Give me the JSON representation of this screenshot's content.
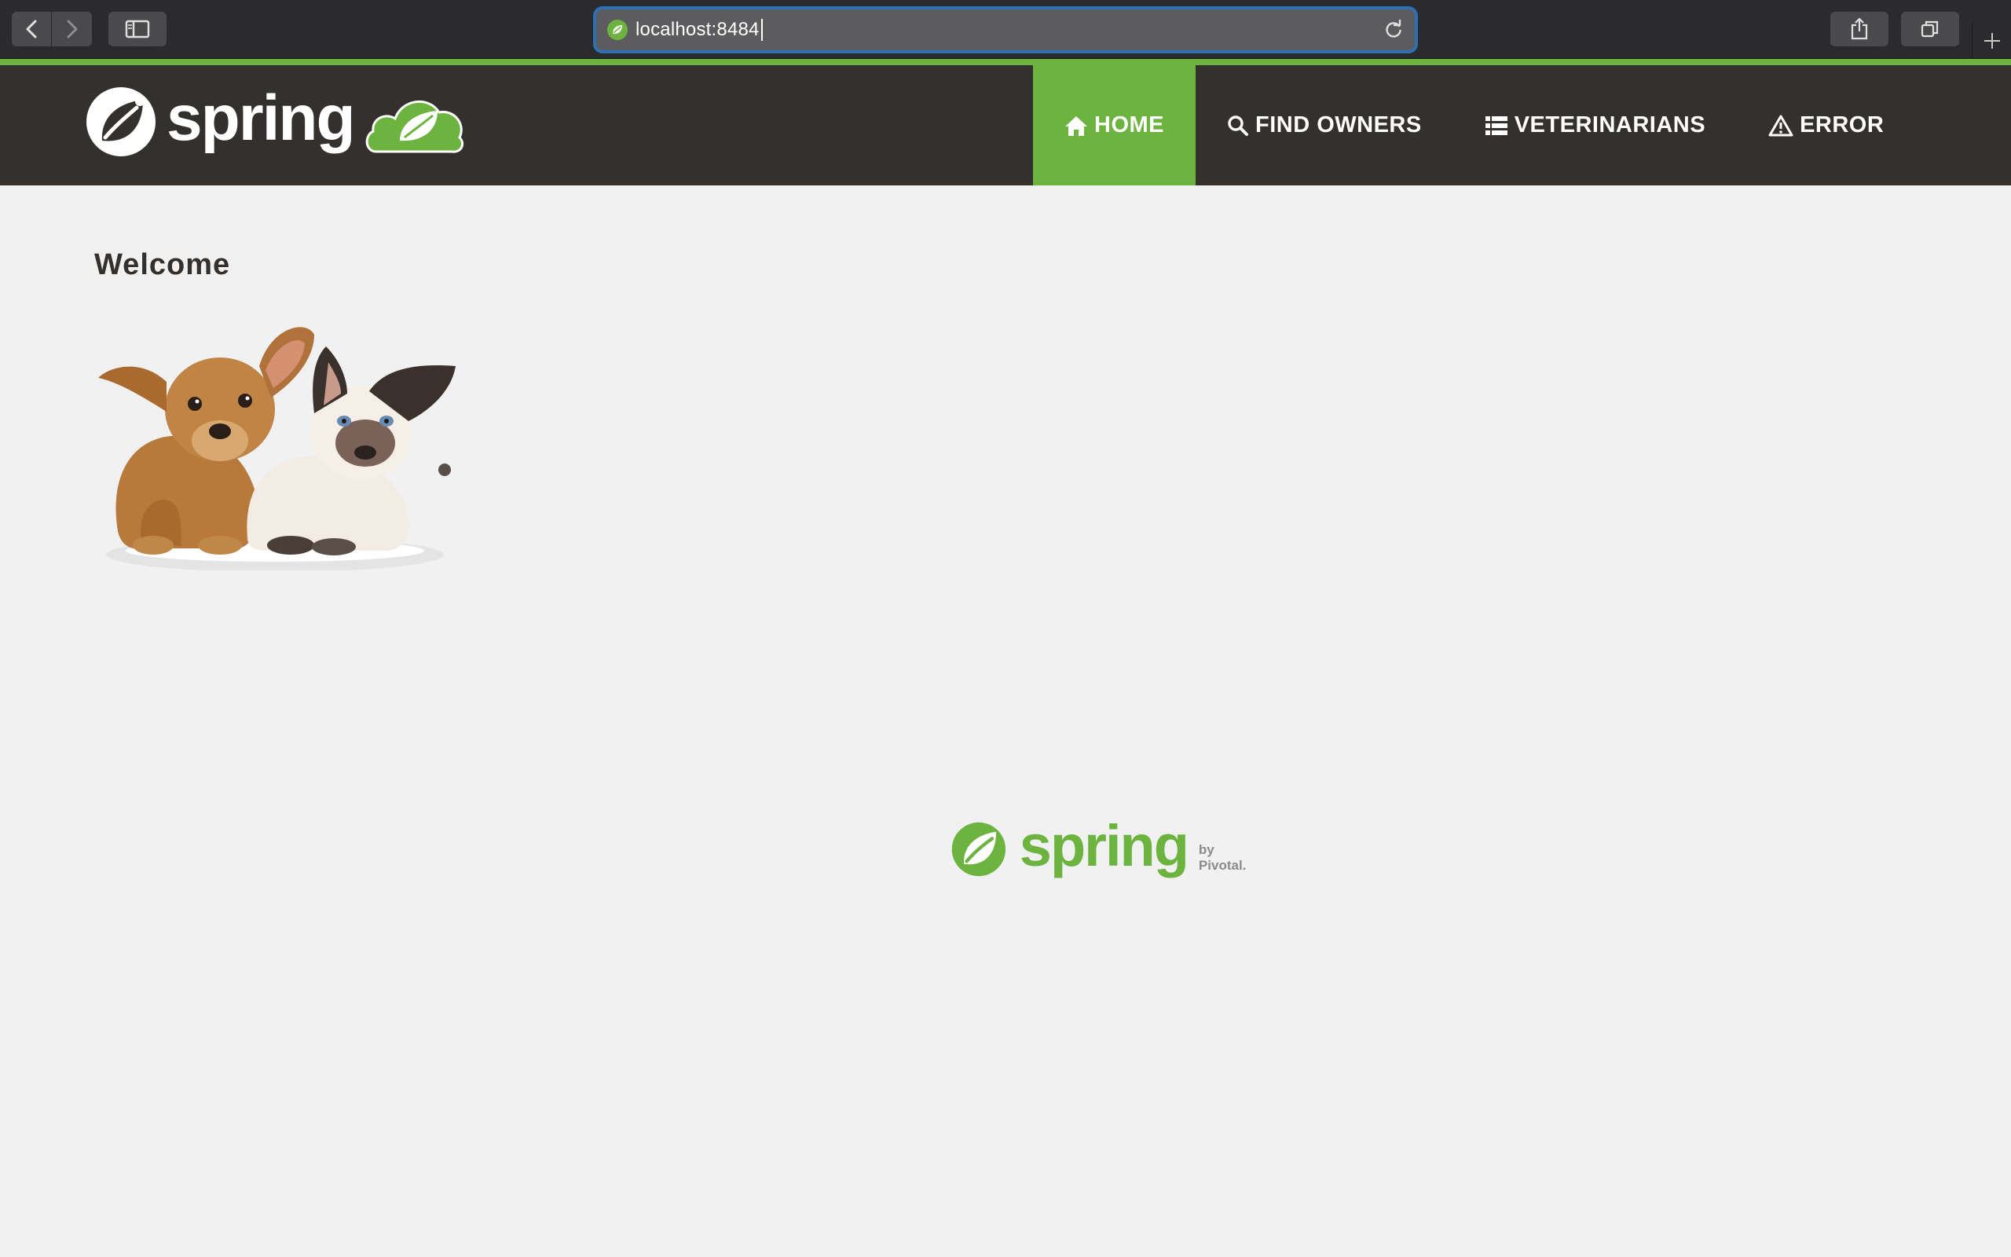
{
  "browser": {
    "url": "localhost:8484",
    "icons": {
      "back": "chevron-left-icon",
      "forward": "chevron-right-icon",
      "sidebar": "sidebar-icon",
      "reload": "reload-icon",
      "share": "share-icon",
      "tabs": "tabs-icon",
      "new_tab": "plus-icon"
    }
  },
  "site": {
    "brand": "spring",
    "nav": {
      "items": [
        {
          "label": "HOME",
          "icon": "home-icon",
          "active": true
        },
        {
          "label": "FIND OWNERS",
          "icon": "search-icon",
          "active": false
        },
        {
          "label": "VETERINARIANS",
          "icon": "list-icon",
          "active": false
        },
        {
          "label": "ERROR",
          "icon": "warning-icon",
          "active": false
        }
      ]
    },
    "page_title": "Welcome",
    "image_alt": "dog-and-cat-image",
    "footer": {
      "word": "spring",
      "by": "by Pivotal."
    }
  },
  "colors": {
    "brand_green": "#6db33f",
    "nav_dark": "#34302d",
    "page_bg": "#f1f1f1",
    "chrome_bg": "#2b2b2d",
    "focus_ring": "#2f6fb5"
  }
}
